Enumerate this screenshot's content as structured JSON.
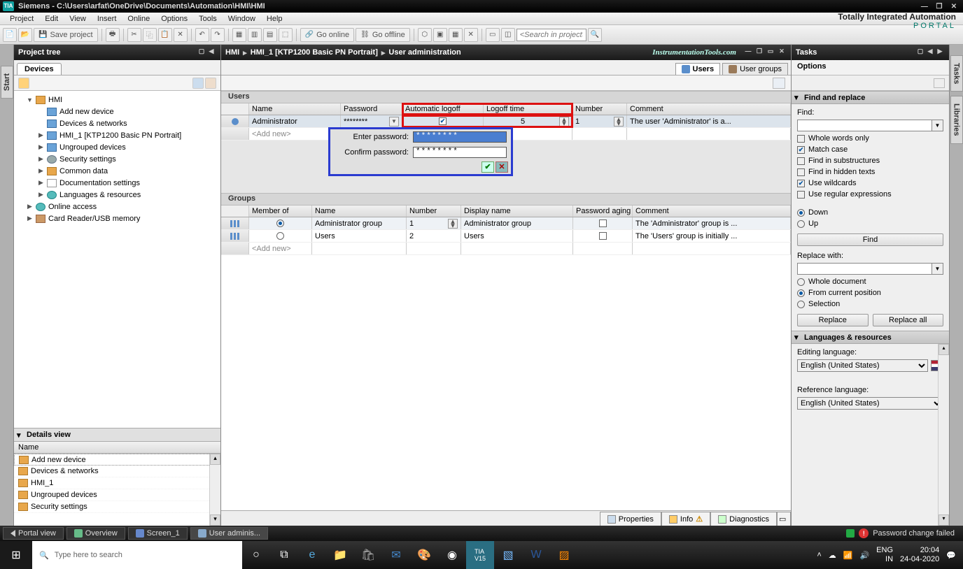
{
  "titlebar": {
    "app": "Siemens",
    "path": "C:\\Users\\arfat\\OneDrive\\Documents\\Automation\\HMI\\HMI"
  },
  "menu": [
    "Project",
    "Edit",
    "View",
    "Insert",
    "Online",
    "Options",
    "Tools",
    "Window",
    "Help"
  ],
  "branding": {
    "line1": "Totally Integrated Automation",
    "line2": "PORTAL"
  },
  "toolbar": {
    "save": "Save project",
    "go_online": "Go online",
    "go_offline": "Go offline",
    "search_placeholder": "<Search in project>"
  },
  "lefttab": "Start",
  "projtree": {
    "title": "Project tree",
    "tab": "Devices",
    "nodes": [
      {
        "t": "HMI",
        "lvl": 0,
        "exp": "▼",
        "ico": "folder"
      },
      {
        "t": "Add new device",
        "lvl": 1,
        "ico": "device"
      },
      {
        "t": "Devices & networks",
        "lvl": 1,
        "ico": "device"
      },
      {
        "t": "HMI_1 [KTP1200 Basic PN Portrait]",
        "lvl": 1,
        "exp": "▶",
        "ico": "device"
      },
      {
        "t": "Ungrouped devices",
        "lvl": 1,
        "exp": "▶",
        "ico": "device"
      },
      {
        "t": "Security settings",
        "lvl": 1,
        "exp": "▶",
        "ico": "gear"
      },
      {
        "t": "Common data",
        "lvl": 1,
        "exp": "▶",
        "ico": "folder"
      },
      {
        "t": "Documentation settings",
        "lvl": 1,
        "exp": "▶",
        "ico": "doc"
      },
      {
        "t": "Languages & resources",
        "lvl": 1,
        "exp": "▶",
        "ico": "world"
      },
      {
        "t": "Online access",
        "lvl": 0,
        "exp": "▶",
        "ico": "world"
      },
      {
        "t": "Card Reader/USB memory",
        "lvl": 0,
        "exp": "▶",
        "ico": "card"
      }
    ]
  },
  "detailsview": {
    "title": "Details view",
    "col": "Name",
    "rows": [
      "Add new device",
      "Devices & networks",
      "HMI_1",
      "Ungrouped devices",
      "Security settings"
    ]
  },
  "crumb": [
    "HMI",
    "HMI_1 [KTP1200 Basic PN Portrait]",
    "User administration"
  ],
  "watermark": "InstrumentationTools.com",
  "edtabs": {
    "users": "Users",
    "groups": "User groups"
  },
  "users": {
    "title": "Users",
    "cols": [
      "Name",
      "Password",
      "Automatic logoff",
      "Logoff time",
      "Number",
      "Comment"
    ],
    "row": {
      "name": "Administrator",
      "password": "********",
      "auto_logoff": true,
      "logoff_time": "5",
      "number": "1",
      "comment": "The user 'Administrator' is a..."
    },
    "addnew": "<Add new>",
    "pwdpop": {
      "enter": "Enter password:",
      "confirm": "Confirm password:",
      "val": "********"
    }
  },
  "groups": {
    "title": "Groups",
    "cols": [
      "Member of",
      "Name",
      "Number",
      "Display name",
      "Password aging",
      "Comment"
    ],
    "rows": [
      {
        "member": true,
        "name": "Administrator group",
        "number": "1",
        "display": "Administrator group",
        "aging": false,
        "comment": "The 'Administrator' group is ..."
      },
      {
        "member": false,
        "name": "Users",
        "number": "2",
        "display": "Users",
        "aging": false,
        "comment": "The 'Users' group is initially ..."
      }
    ],
    "addnew": "<Add new>"
  },
  "edfoot": {
    "props": "Properties",
    "info": "Info",
    "diag": "Diagnostics"
  },
  "tasks": {
    "title": "Tasks",
    "options": "Options",
    "find_title": "Find and replace",
    "find_label": "Find:",
    "replace_label": "Replace with:",
    "whole": "Whole words only",
    "match": "Match case",
    "subst": "Find in substructures",
    "hidden": "Find in hidden texts",
    "wild": "Use wildcards",
    "regex": "Use regular expressions",
    "down": "Down",
    "up": "Up",
    "wholedoc": "Whole document",
    "curpos": "From current position",
    "sel": "Selection",
    "find_btn": "Find",
    "replace_btn": "Replace",
    "replaceall_btn": "Replace all",
    "lang_title": "Languages & resources",
    "editlang": "Editing language:",
    "reflang": "Reference language:",
    "lang_value": "English (United States)"
  },
  "right_tabs": [
    "Tasks",
    "Libraries"
  ],
  "statusbar": {
    "portal": "Portal view",
    "overview": "Overview",
    "screen": "Screen_1",
    "useradmin": "User adminis...",
    "err_msg": "Password change failed"
  },
  "taskbar": {
    "search_placeholder": "Type here to search",
    "lang": "ENG",
    "region": "IN",
    "time": "20:04",
    "date": "24-04-2020"
  }
}
